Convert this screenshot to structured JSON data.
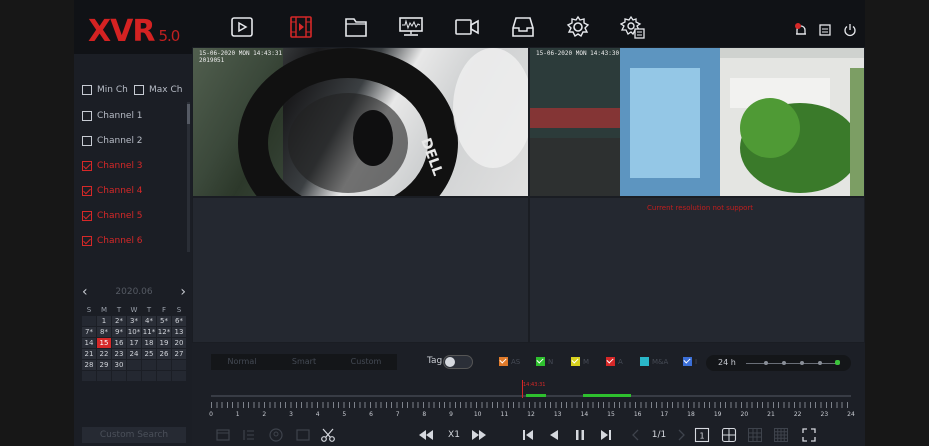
{
  "app": {
    "logo": "XVR",
    "version": "5.0"
  },
  "topnav": {
    "items": [
      {
        "name": "live-view-icon"
      },
      {
        "name": "playback-icon",
        "active": true
      },
      {
        "name": "file-manage-icon"
      },
      {
        "name": "system-info-icon"
      },
      {
        "name": "camera-icon"
      },
      {
        "name": "backup-icon"
      },
      {
        "name": "settings-icon"
      },
      {
        "name": "advanced-settings-icon"
      }
    ],
    "right_icons": [
      "alarm-icon",
      "message-icon",
      "power-icon"
    ]
  },
  "channels": {
    "min_label": "Min Ch",
    "max_label": "Max Ch",
    "items": [
      {
        "label": "Channel 1",
        "checked": false
      },
      {
        "label": "Channel 2",
        "checked": false
      },
      {
        "label": "Channel 3",
        "checked": true
      },
      {
        "label": "Channel 4",
        "checked": true
      },
      {
        "label": "Channel 5",
        "checked": true
      },
      {
        "label": "Channel 6",
        "checked": true
      }
    ]
  },
  "calendar": {
    "month": "2020.06",
    "weekdays": [
      "S",
      "M",
      "T",
      "W",
      "T",
      "F",
      "S"
    ],
    "days": [
      "",
      "1",
      "2*",
      "3*",
      "4*",
      "5*",
      "6*",
      "7*",
      "8*",
      "9*",
      "10*",
      "11*",
      "12*",
      "13",
      "14",
      "15",
      "16",
      "17",
      "18",
      "19",
      "20",
      "21",
      "22",
      "23",
      "24",
      "25",
      "26",
      "27",
      "28",
      "29",
      "30",
      "",
      "",
      "",
      "",
      "",
      "",
      "",
      "",
      "",
      "",
      ""
    ],
    "today": "15"
  },
  "custom_search": "Custom Search",
  "video": {
    "tile1_timestamp": "15-06-2020 MON 14:43:31",
    "tile1_sub": "2019051",
    "tile2_timestamp": "15-06-2020 MON 14:43:30",
    "no_signal": "Current resolution not support"
  },
  "modes": [
    "Normal",
    "Smart",
    "Custom"
  ],
  "tag_label": "Tag",
  "legend": [
    {
      "label": "AS",
      "color": "#e07a2a"
    },
    {
      "label": "N",
      "color": "#2ec02e"
    },
    {
      "label": "M",
      "color": "#d8d21e"
    },
    {
      "label": "A",
      "color": "#d62828"
    },
    {
      "label": "M&A",
      "color": "#2ab7c9"
    },
    {
      "label": "I",
      "color": "#3b6fd8"
    }
  ],
  "zoom": {
    "label": "24 h"
  },
  "timeline": {
    "cursor_time": "14:43:31",
    "hours": [
      "0",
      "1",
      "2",
      "3",
      "4",
      "5",
      "6",
      "7",
      "8",
      "9",
      "10",
      "11",
      "12",
      "13",
      "14",
      "15",
      "16",
      "17",
      "18",
      "19",
      "20",
      "21",
      "22",
      "23",
      "24"
    ]
  },
  "controls": {
    "speed": "X1",
    "page": "1/1"
  }
}
